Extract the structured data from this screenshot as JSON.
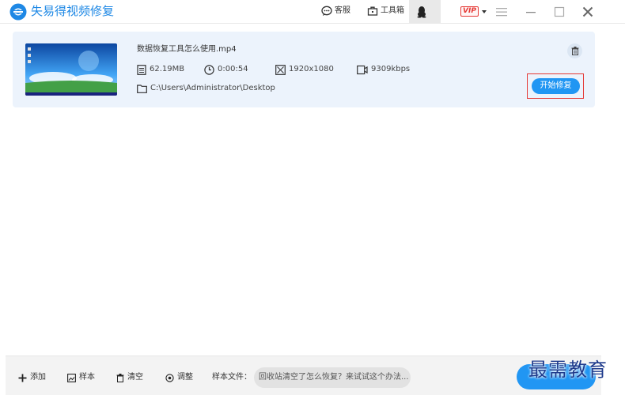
{
  "titlebar": {
    "app_title": "失易得视频修复",
    "service_label": "客服",
    "toolbox_label": "工具箱",
    "vip_label": "VIP"
  },
  "file": {
    "name": "数据恢复工具怎么使用.mp4",
    "size": "62.19MB",
    "duration": "0:00:54",
    "resolution": "1920x1080",
    "bitrate": "9309kbps",
    "path": "C:\\Users\\Administrator\\Desktop",
    "start_label": "开始修复"
  },
  "bottombar": {
    "add_label": "添加",
    "sample_label": "样本",
    "clear_label": "清空",
    "adjust_label": "调整",
    "sample_file_label": "样本文件：",
    "sample_tip": "回收站清空了怎么恢复？来试试这个办法..."
  },
  "watermark": "最需教育",
  "colors": {
    "accent": "#2196f3",
    "title": "#1e88e5",
    "card_bg": "#ecf3fc",
    "highlight": "#e53935"
  }
}
